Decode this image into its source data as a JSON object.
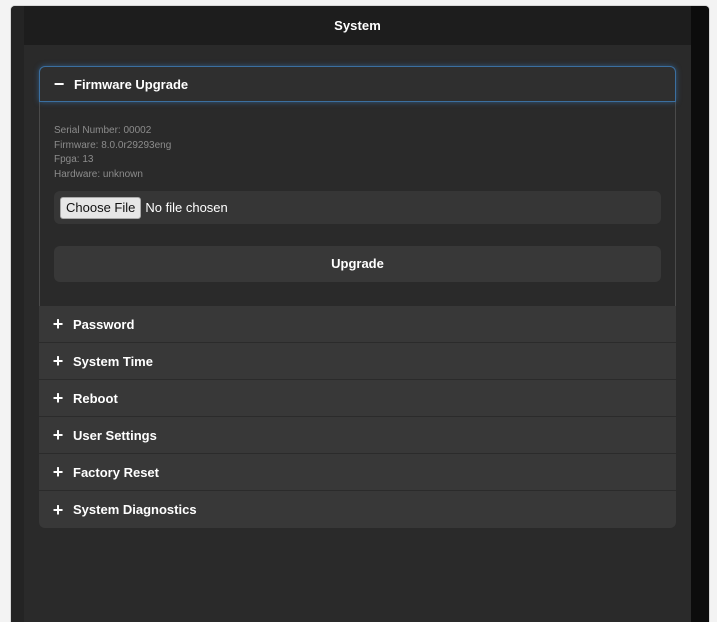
{
  "window": {
    "title": "System"
  },
  "firmware": {
    "header_label": "Firmware Upgrade",
    "header_icon": "minus-icon",
    "serial_number": "Serial Number: 00002",
    "firmware_version": "Firmware: 8.0.0r29293eng",
    "fpga": "Fpga: 13",
    "hardware": "Hardware: unknown",
    "choose_file_label": "Choose File",
    "file_status": "No file chosen",
    "upgrade_label": "Upgrade"
  },
  "sections": [
    {
      "label": "Password",
      "icon": "plus-icon"
    },
    {
      "label": "System Time",
      "icon": "plus-icon"
    },
    {
      "label": "Reboot",
      "icon": "plus-icon"
    },
    {
      "label": "User Settings",
      "icon": "plus-icon"
    },
    {
      "label": "Factory Reset",
      "icon": "plus-icon"
    },
    {
      "label": "System Diagnostics",
      "icon": "plus-icon"
    }
  ],
  "colors": {
    "background": "#2a2a2a",
    "title_bar": "#1d1d1d",
    "panel_header": "#383838",
    "focus_outline": "#3b6fa0",
    "muted_text": "#8c8c8c"
  }
}
